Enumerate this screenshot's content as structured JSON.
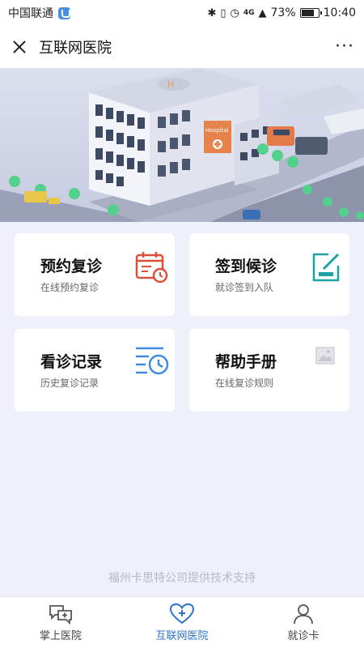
{
  "status_bar": {
    "carrier": "中国联通",
    "network": "4G",
    "battery": "73%",
    "time": "10:40"
  },
  "header": {
    "title": "互联网医院",
    "more": "···"
  },
  "banner": {
    "sign_text": "Hospital"
  },
  "cards": [
    {
      "title": "预约复诊",
      "subtitle": "在线预约复诊",
      "icon": "calendar-clock-icon",
      "icon_color": "#d9503b"
    },
    {
      "title": "签到候诊",
      "subtitle": "就诊签到入队",
      "icon": "edit-square-icon",
      "icon_color": "#1aa3a0"
    },
    {
      "title": "看诊记录",
      "subtitle": "历史复诊记录",
      "icon": "list-clock-icon",
      "icon_color": "#3f8be0"
    },
    {
      "title": "帮助手册",
      "subtitle": "在线复诊规则",
      "icon": "image-placeholder-icon",
      "icon_color": "#cfd2d8"
    }
  ],
  "footer_note": "福州卡思特公司提供技术支持",
  "tabs": [
    {
      "label": "掌上医院",
      "icon": "chat-bubbles-icon",
      "active": false
    },
    {
      "label": "互联网医院",
      "icon": "heart-plus-icon",
      "active": true
    },
    {
      "label": "就诊卡",
      "icon": "person-icon",
      "active": false
    }
  ],
  "colors": {
    "accent": "#2a73c8",
    "background": "#eef1fa"
  }
}
